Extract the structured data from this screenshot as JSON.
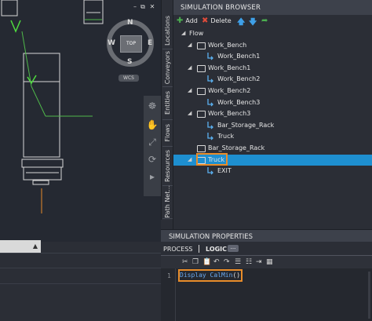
{
  "browser": {
    "title": "SIMULATION BROWSER",
    "toolbar": {
      "add_label": "Add",
      "delete_label": "Delete"
    },
    "tree": [
      {
        "label": "Flow",
        "level": 0,
        "expanded": true,
        "icon": "none"
      },
      {
        "label": "Work_Bench",
        "level": 1,
        "expanded": true,
        "icon": "box-icon"
      },
      {
        "label": "Work_Bench1",
        "level": 2,
        "icon": "route-icon"
      },
      {
        "label": "Work_Bench1",
        "level": 1,
        "expanded": true,
        "icon": "box-icon"
      },
      {
        "label": "Work_Bench2",
        "level": 2,
        "icon": "route-icon"
      },
      {
        "label": "Work_Bench2",
        "level": 1,
        "expanded": true,
        "icon": "box-icon"
      },
      {
        "label": "Work_Bench3",
        "level": 2,
        "icon": "route-icon"
      },
      {
        "label": "Work_Bench3",
        "level": 1,
        "expanded": true,
        "icon": "box-icon"
      },
      {
        "label": "Bar_Storage_Rack",
        "level": 2,
        "icon": "route-icon"
      },
      {
        "label": "Truck",
        "level": 2,
        "icon": "route-icon"
      },
      {
        "label": "Bar_Storage_Rack",
        "level": 1,
        "icon": "box-icon"
      },
      {
        "label": "Truck",
        "level": 1,
        "expanded": true,
        "icon": "box-icon",
        "selected": true
      },
      {
        "label": "EXIT",
        "level": 2,
        "icon": "route-icon"
      }
    ]
  },
  "side_tabs": [
    "Locations",
    "Conveyors",
    "Entities",
    "Flows",
    "Resources",
    "Path Net..."
  ],
  "viewport": {
    "compass": {
      "north": "N",
      "south": "S",
      "east": "E",
      "west": "W"
    },
    "view_cube_label": "TOP",
    "ucs_label": "WCS"
  },
  "properties": {
    "title": "SIMULATION PROPERTIES",
    "tabs": {
      "process": "PROCESS",
      "logic": "LOGIC",
      "more": "..."
    },
    "editor": {
      "line_number": "1",
      "code_keyword": "Display CalMin",
      "code_parens": "()"
    }
  },
  "colors": {
    "selection": "#1e8fd0",
    "highlight_outline": "#e88c2a",
    "add_icon": "#4caf50",
    "delete_icon": "#e04b3a",
    "code_text": "#6aa9f0"
  }
}
